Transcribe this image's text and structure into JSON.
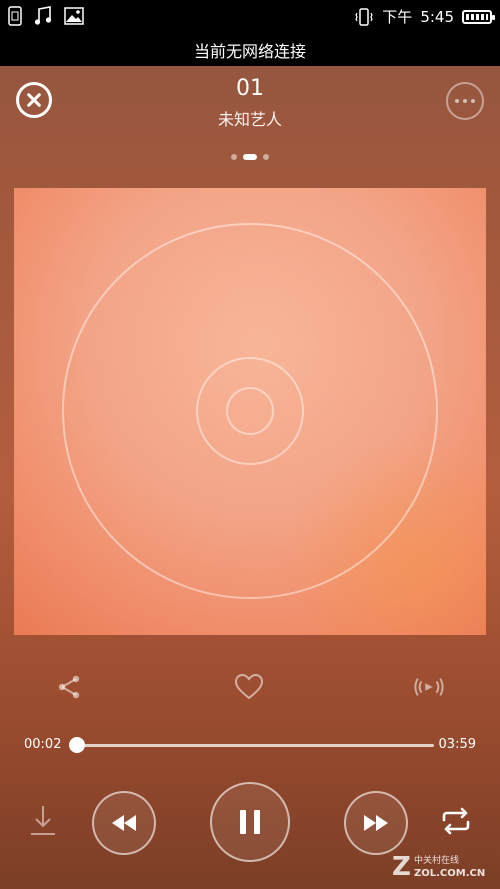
{
  "status_bar": {
    "time_period": "下午",
    "time": "5:45"
  },
  "network_banner": "当前无网络连接",
  "header": {
    "track_title": "01",
    "artist": "未知艺人"
  },
  "pager": {
    "pages": 3,
    "active_index": 1
  },
  "progress": {
    "current_time": "00:02",
    "total_time": "03:59",
    "fraction": 0.008
  },
  "icons": {
    "close": "close-circle-icon",
    "more": "more-dots-icon",
    "share": "share-icon",
    "favorite": "heart-icon",
    "broadcast": "broadcast-icon",
    "download": "download-icon",
    "previous": "rewind-icon",
    "pause": "pause-icon",
    "next": "fast-forward-icon",
    "repeat": "repeat-icon"
  },
  "watermark": {
    "brand_text": "中关村在线",
    "domain_text": "ZOL.COM.CN"
  }
}
